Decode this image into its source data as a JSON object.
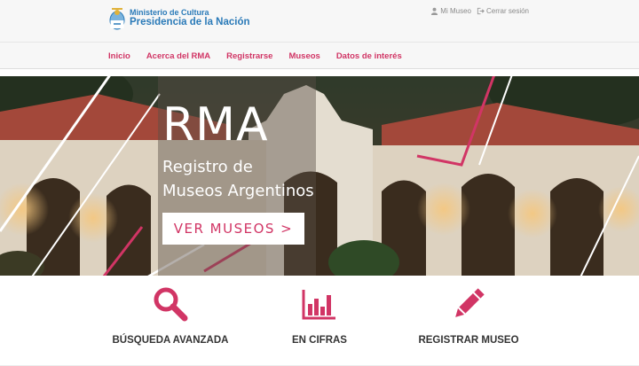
{
  "header": {
    "logo_line1": "Ministerio de Cultura",
    "logo_line2": "Presidencia de la Nación",
    "account_link": "Mi Museo",
    "logout_link": "Cerrar sesión"
  },
  "nav": {
    "items": [
      {
        "label": "Inicio"
      },
      {
        "label": "Acerca del RMA"
      },
      {
        "label": "Registrarse"
      },
      {
        "label": "Museos"
      },
      {
        "label": "Datos de interés"
      }
    ]
  },
  "hero": {
    "title": "RMA",
    "subtitle_line1": "Registro de",
    "subtitle_line2": "Museos Argentinos",
    "cta": "VER MUSEOS >"
  },
  "features": [
    {
      "label": "BÚSQUEDA AVANZADA",
      "icon": "search-icon"
    },
    {
      "label": "EN CIFRAS",
      "icon": "bar-chart-icon"
    },
    {
      "label": "REGISTRAR MUSEO",
      "icon": "pencil-icon"
    }
  ],
  "colors": {
    "accent": "#d13565",
    "brand_blue": "#2a7ab8",
    "header_bg": "#f7f7f7"
  }
}
